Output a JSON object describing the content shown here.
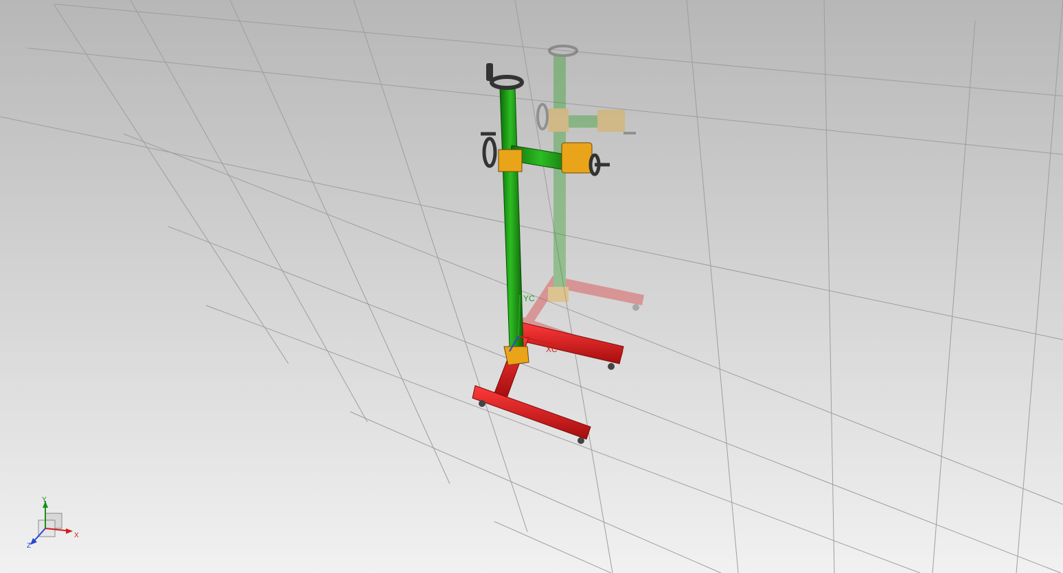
{
  "viewport": {
    "background_top": "#b7b7b7",
    "background_bottom": "#f1f1f1",
    "grid_color": "#9d9d9d"
  },
  "model": {
    "active": {
      "frame_color": "#dd1f1f",
      "column_color": "#1e9b15",
      "fitting_color": "#e9a419",
      "handwheel_color": "#333333"
    },
    "ghost": {
      "opacity": "0.35"
    }
  },
  "wcs": {
    "xc_label": "XC",
    "yc_label": "YC",
    "xc_color": "#d31d1d",
    "yc_color": "#23a11e"
  },
  "triad": {
    "x_label": "X",
    "y_label": "Y",
    "z_label": "Z",
    "x_color": "#d11e1e",
    "y_color": "#1b8f1b",
    "z_color": "#2a45d1"
  }
}
